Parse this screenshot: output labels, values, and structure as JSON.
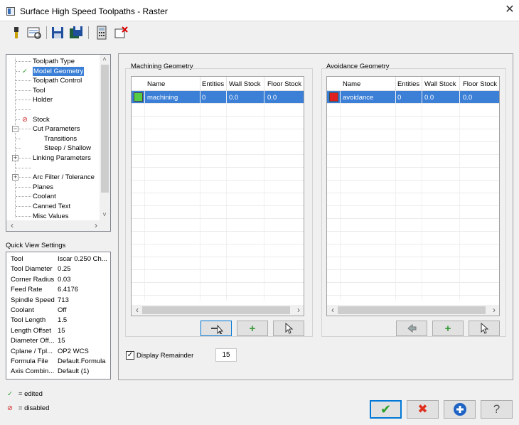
{
  "window": {
    "title": "Surface High Speed Toolpaths - Raster",
    "close_glyph": "✕"
  },
  "toolbar": {
    "icons": [
      "tool-icon",
      "preview-icon",
      "save-icon",
      "save-all-icon",
      "calculator-icon",
      "clear-icon"
    ]
  },
  "tree": {
    "items": [
      {
        "label": "Toolpath Type"
      },
      {
        "label": "Model Geometry",
        "status": "✓",
        "selected": true
      },
      {
        "label": "Toolpath Control"
      },
      {
        "label": "Tool"
      },
      {
        "label": "Holder"
      },
      {
        "label": ""
      },
      {
        "label": "Stock",
        "status": "⊘"
      },
      {
        "label": "Cut Parameters",
        "expander": "−"
      },
      {
        "label": "Transitions"
      },
      {
        "label": "Steep / Shallow"
      },
      {
        "label": "Linking Parameters",
        "expander": "+"
      },
      {
        "label": ""
      },
      {
        "label": "Arc Filter / Tolerance",
        "expander": "+"
      },
      {
        "label": "Planes"
      },
      {
        "label": "Coolant"
      },
      {
        "label": "Canned Text"
      },
      {
        "label": "Misc Values"
      }
    ]
  },
  "quick_view": {
    "title": "Quick View Settings",
    "rows": [
      {
        "k": "Tool",
        "v": "Iscar 0.250 Ch..."
      },
      {
        "k": "Tool Diameter",
        "v": "0.25"
      },
      {
        "k": "Corner Radius",
        "v": "0.03"
      },
      {
        "k": "Feed Rate",
        "v": "6.4176"
      },
      {
        "k": "Spindle Speed",
        "v": "713"
      },
      {
        "k": "Coolant",
        "v": "Off"
      },
      {
        "k": "Tool Length",
        "v": "1.5"
      },
      {
        "k": "Length Offset",
        "v": "15"
      },
      {
        "k": "Diameter Off...",
        "v": "15"
      },
      {
        "k": "Cplane / Tpl...",
        "v": "OP2 WCS"
      },
      {
        "k": "Formula File",
        "v": "Default.Formula"
      },
      {
        "k": "Axis Combin...",
        "v": "Default (1)"
      }
    ]
  },
  "legend": {
    "edited_glyph": "✓",
    "edited_label": "= edited",
    "disabled_glyph": "⊘",
    "disabled_label": "= disabled"
  },
  "machining": {
    "title": "Machining Geometry",
    "columns": [
      "Name",
      "Entities",
      "Wall Stock",
      "Floor Stock"
    ],
    "row": {
      "color": "#55cc44",
      "name": "machining",
      "entities": "0",
      "wall": "0.0",
      "floor": "0.0"
    }
  },
  "avoidance": {
    "title": "Avoidance Geometry",
    "columns": [
      "Name",
      "Entities",
      "Wall Stock",
      "Floor Stock"
    ],
    "row": {
      "color": "#e02020",
      "name": "avoidance",
      "entities": "0",
      "wall": "0.0",
      "floor": "0.0"
    }
  },
  "display_remainder": {
    "label": "Display Remainder",
    "checked": true,
    "value": "15"
  },
  "scroll": {
    "left": "‹",
    "right": "›",
    "up": "˄",
    "down": "˅"
  },
  "buttons": {
    "check": "✔",
    "cancel": "✖",
    "add": "+",
    "help": "?"
  }
}
